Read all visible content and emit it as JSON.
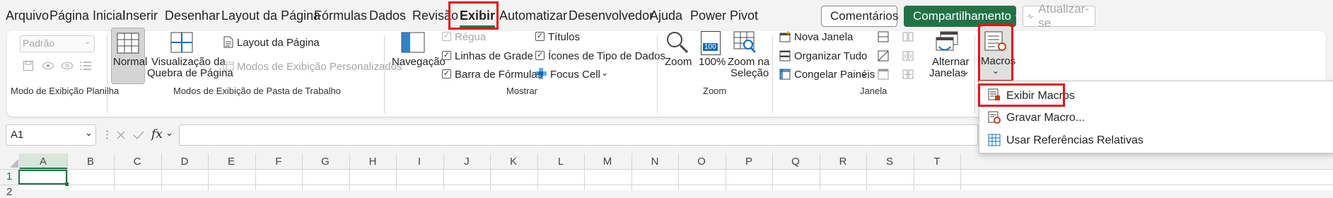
{
  "menu": {
    "tabs": [
      "Arquivo",
      "Página Inicial",
      "Inserir",
      "Desenhar",
      "Layout da Página",
      "Fórmulas",
      "Dados",
      "Revisão",
      "Exibir",
      "Automatizar",
      "Desenvolvedor",
      "Ajuda",
      "Power Pivot"
    ],
    "selected_tab": "Exibir",
    "comments_label": "Comentários",
    "share_label": "Compartilhamento",
    "update_label": "Atualizar-se"
  },
  "ribbon": {
    "sheet_view": {
      "dropdown_value": "Padrão",
      "group_label": "Modo de Exibição Planilha"
    },
    "workbook_views": {
      "normal_label": "Normal",
      "page_break_label_1": "Visualização da",
      "page_break_label_2": "Quebra de Página",
      "page_layout_label": "Layout da Página",
      "custom_views_label": "Modos de Exibição Personalizados",
      "group_label": "Modos de Exibição de Pasta de Trabalho"
    },
    "show": {
      "navigation_label": "Navegação",
      "ruler_label": "Régua",
      "gridlines_label": "Linhas de Grade",
      "formula_bar_label": "Barra de Fórmulas",
      "headings_label": "Títulos",
      "data_type_icons_label": "Ícones de Tipo de Dados",
      "focus_cell_label": "Focus Cell",
      "group_label": "Mostrar"
    },
    "zoom": {
      "zoom_label": "Zoom",
      "percent_label": "100%",
      "zoom_selection_label_1": "Zoom na",
      "zoom_selection_label_2": "Seleção",
      "group_label": "Zoom",
      "percent_icon_text": "100"
    },
    "window": {
      "new_window_label": "Nova Janela",
      "arrange_all_label": "Organizar Tudo",
      "freeze_panes_label": "Congelar Painéis",
      "switch_windows_label_1": "Alternar",
      "switch_windows_label_2": "Janelas",
      "group_label": "Janela"
    },
    "macros": {
      "macros_label": "Macros"
    }
  },
  "formula_bar": {
    "name_box": "A1",
    "fx_label": "fx"
  },
  "grid": {
    "columns": [
      "A",
      "B",
      "C",
      "D",
      "E",
      "F",
      "G",
      "H",
      "I",
      "J",
      "K",
      "L",
      "M",
      "N",
      "O",
      "P",
      "Q",
      "R",
      "S",
      "T"
    ],
    "rows": [
      "1",
      "2"
    ]
  },
  "macros_menu": {
    "items": [
      "Exibir Macros",
      "Gravar Macro...",
      "Usar Referências Relativas"
    ]
  },
  "colors": {
    "accent_green": "#217346",
    "highlight_red": "#e0131b"
  }
}
